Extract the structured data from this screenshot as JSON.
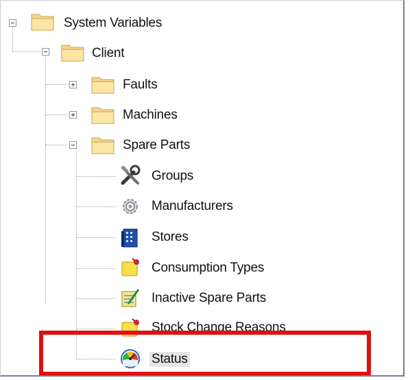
{
  "tree": {
    "root": {
      "label": "System Variables",
      "expander": "minus"
    },
    "client": {
      "label": "Client",
      "expander": "minus"
    },
    "faults": {
      "label": "Faults",
      "expander": "plus"
    },
    "machines": {
      "label": "Machines",
      "expander": "plus"
    },
    "spare_parts": {
      "label": "Spare Parts",
      "expander": "minus"
    },
    "children": [
      {
        "label": "Groups",
        "icon": "tools-icon"
      },
      {
        "label": "Manufacturers",
        "icon": "gear-icon"
      },
      {
        "label": "Stores",
        "icon": "building-icon"
      },
      {
        "label": "Consumption Types",
        "icon": "note-pin-icon"
      },
      {
        "label": "Inactive Spare Parts",
        "icon": "notepad-pencil-icon"
      },
      {
        "label": "Stock Change Reasons",
        "icon": "note-pin-icon"
      },
      {
        "label": "Status",
        "icon": "gauge-icon"
      }
    ]
  },
  "highlight_color": "#e01010"
}
